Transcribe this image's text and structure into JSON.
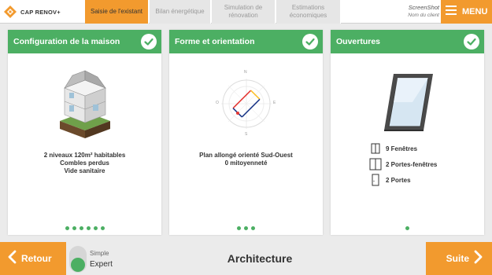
{
  "app": {
    "logo_text": "CAP RENOV+"
  },
  "nav": {
    "tabs": [
      {
        "label": "Saisie de l'existant",
        "active": true
      },
      {
        "label": "Bilan énergétique",
        "active": false
      },
      {
        "label": "Simulation de rénovation",
        "active": false
      },
      {
        "label": "Estimations économiques",
        "active": false
      }
    ]
  },
  "client": {
    "name": "ScreenShot",
    "subtitle": "Nom du client"
  },
  "menu": {
    "label": "MENU",
    "icon": "hamburger-icon"
  },
  "cards": [
    {
      "title": "Configuration de la maison",
      "status_icon": "check-icon",
      "lines": [
        "2 niveaux 120m² habitables",
        "Combles perdus",
        "Vide sanitaire"
      ],
      "dots_count": 6
    },
    {
      "title": "Forme et orientation",
      "status_icon": "check-icon",
      "lines": [
        "Plan allongé orienté Sud-Ouest",
        "0 mitoyenneté"
      ],
      "compass": {
        "n": "N",
        "e": "E",
        "s": "S",
        "o": "O"
      },
      "dots_count": 3
    },
    {
      "title": "Ouvertures",
      "status_icon": "check-icon",
      "openings": [
        {
          "label": "9 Fenêtres",
          "icon": "window-icon"
        },
        {
          "label": "2 Portes-fenêtres",
          "icon": "french-door-icon"
        },
        {
          "label": "2 Portes",
          "icon": "door-icon"
        }
      ],
      "dots_count": 1
    }
  ],
  "footer": {
    "back_label": "Retour",
    "next_label": "Suite",
    "mode_simple": "Simple",
    "mode_expert": "Expert",
    "selected_mode": "Expert",
    "section_title": "Architecture"
  },
  "colors": {
    "orange": "#f29a2e",
    "green": "#4caf63",
    "background": "#ebebeb"
  }
}
